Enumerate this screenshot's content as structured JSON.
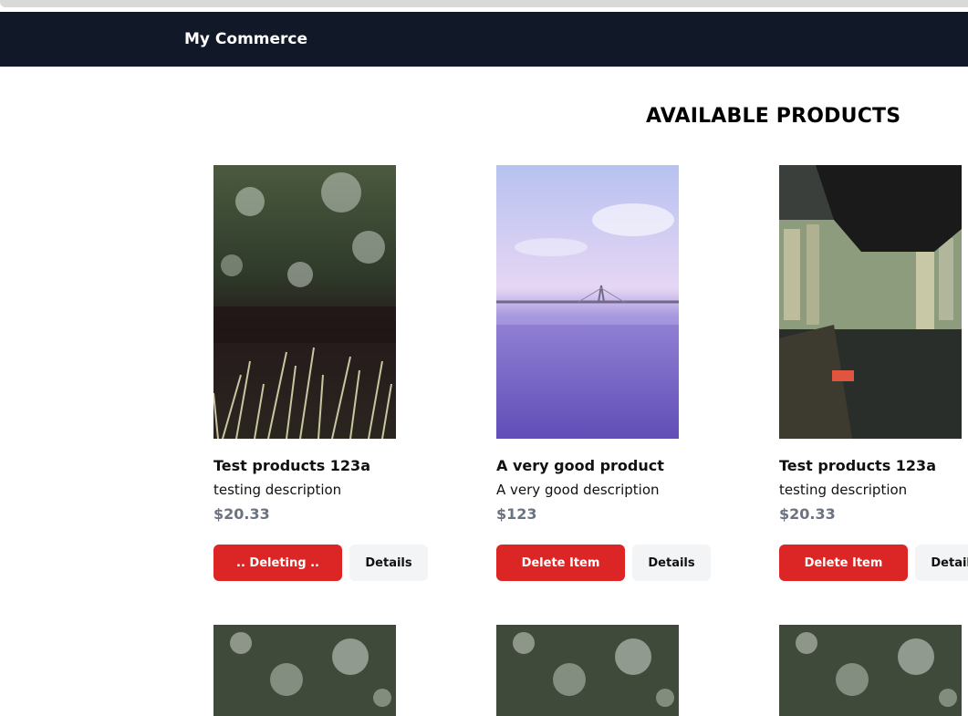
{
  "brand": "My Commerce",
  "page_title": "AVAILABLE PRODUCTS",
  "colors": {
    "navbar": "#111827",
    "delete_button": "#dc2626",
    "details_button": "#f3f4f6",
    "price": "#6b7280"
  },
  "products": [
    {
      "name": "Test products 123a",
      "description": "testing description",
      "price": "$20.33",
      "delete_label": ".. Deleting ..",
      "details_label": "Details",
      "image": "grass-photo"
    },
    {
      "name": "A very good product",
      "description": "A very good description",
      "price": "$123",
      "delete_label": "Delete Item",
      "details_label": "Details",
      "image": "bridge-sea-photo"
    },
    {
      "name": "Test products 123a",
      "description": "testing description",
      "price": "$20.33",
      "delete_label": "Delete Item",
      "details_label": "Details",
      "image": "city-blur-photo"
    }
  ],
  "second_row_images": [
    "tree-bokeh-photo",
    "tree-bokeh-photo",
    "tree-bokeh-photo"
  ]
}
